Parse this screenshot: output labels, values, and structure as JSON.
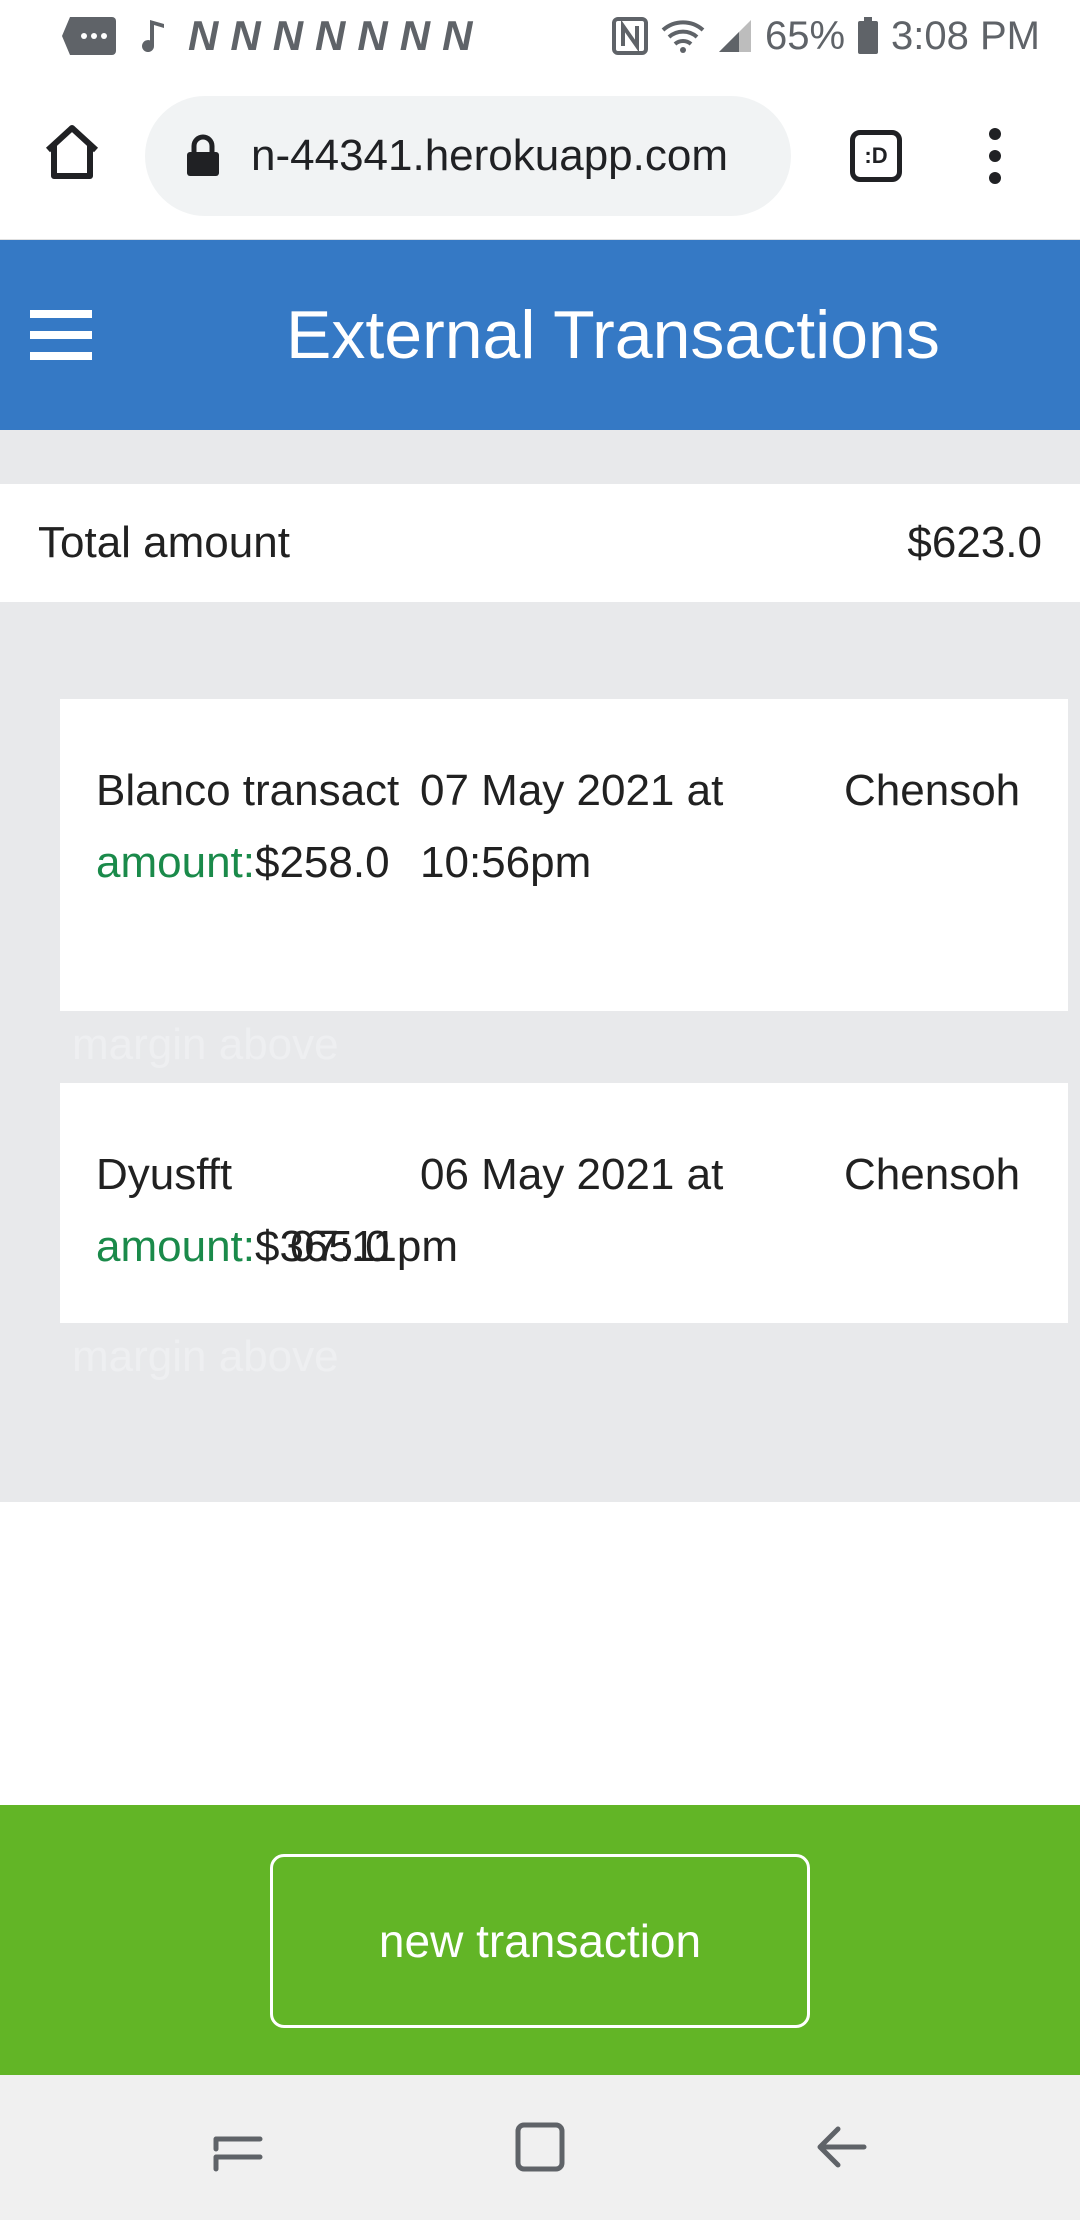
{
  "status_bar": {
    "battery": "65%",
    "time": "3:08 PM",
    "icons": [
      "message-icon",
      "music-note-icon",
      "netflix-icon",
      "nfc-icon",
      "wifi-icon",
      "signal-icon",
      "battery-icon"
    ]
  },
  "browser": {
    "url": "n-44341.herokuapp.com",
    "tab_label": ":D"
  },
  "header": {
    "title": "External Transactions"
  },
  "total": {
    "label": "Total amount",
    "value": "$623.0"
  },
  "transactions": [
    {
      "name": "Blanco transact",
      "date": "07 May 2021 at 10:56pm",
      "user": "Chensoh",
      "amount_label": "amount:",
      "amount": "$258.0"
    },
    {
      "name": "Dyusfft",
      "date_line1": "06 May 2021 at",
      "date_line2": "07:11pm",
      "user": "Chensoh",
      "amount_label": "amount:",
      "amount": "$365.0"
    }
  ],
  "ghost_text": "margin above",
  "footer": {
    "button_label": "new transaction"
  },
  "colors": {
    "header_bg": "#3579c5",
    "footer_bg": "#62b526",
    "amount_label": "#1a8a4a",
    "main_bg": "#e8e9eb"
  }
}
